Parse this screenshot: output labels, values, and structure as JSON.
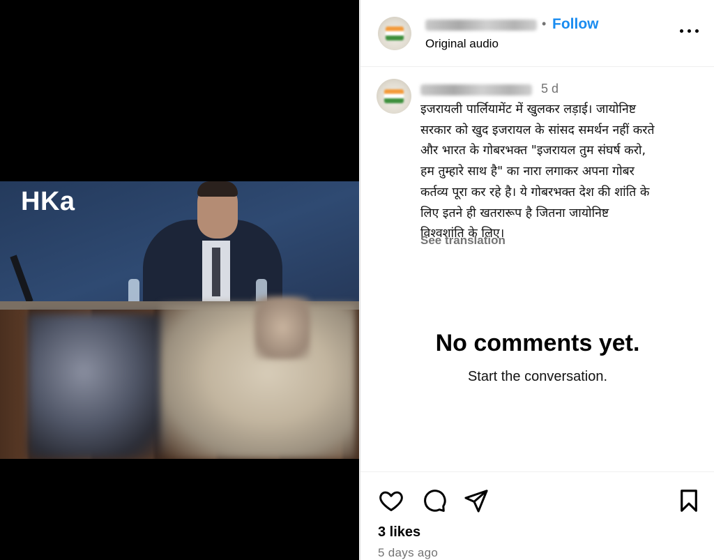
{
  "media": {
    "watermark": "HKa"
  },
  "header": {
    "separator": "•",
    "follow_label": "Follow",
    "audio_label": "Original audio",
    "more_icon": "more-horizontal-icon"
  },
  "caption": {
    "time": "5 d",
    "text": "इजरायली पार्लियामेंट में खुलकर लड़ाई। जायोनिष्ट\nसरकार को खुद इजरायल के सांसद समर्थन नहीं करते\nऔर भारत के गोबरभक्त \"इजरायल तुम संघर्ष करो,\nहम तुम्हारे साथ है\" का नारा लगाकर अपना गोबर\nकर्तव्य पूरा कर रहे है। ये गोबरभक्त देश की शांति के\nलिए इतने ही खतरारूप है जितना जायोनिष्ट\nविश्वशांति के लिए।",
    "see_translation": "See translation"
  },
  "comments": {
    "empty_title": "No comments yet.",
    "empty_subtitle": "Start the conversation."
  },
  "actions": {
    "icons": [
      "heart-icon",
      "comment-icon",
      "share-icon",
      "bookmark-icon"
    ],
    "likes": "3 likes",
    "posted": "5 days ago"
  },
  "colors": {
    "follow": "#1a8cf0",
    "secondary_text": "#737373",
    "media_background": "#000000"
  }
}
